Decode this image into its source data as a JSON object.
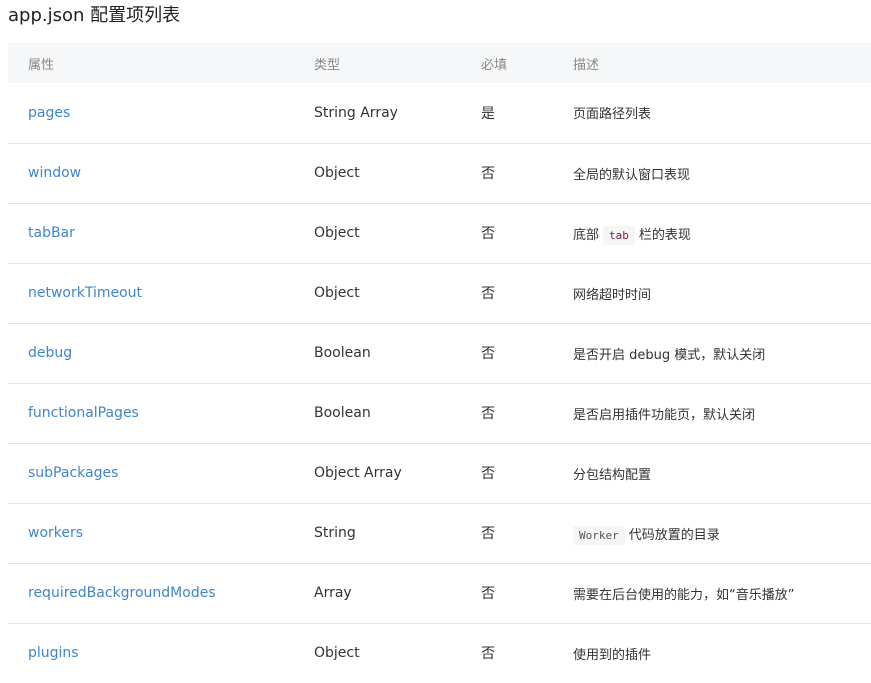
{
  "title": "app.json 配置项列表",
  "headers": [
    "属性",
    "类型",
    "必填",
    "描述"
  ],
  "rows": [
    {
      "name": "pages",
      "type": "String Array",
      "required": "是",
      "desc": "页面路径列表"
    },
    {
      "name": "window",
      "type": "Object",
      "required": "否",
      "desc": "全局的默认窗口表现"
    },
    {
      "name": "tabBar",
      "type": "Object",
      "required": "否",
      "desc_before": "底部",
      "desc_code": "tab",
      "desc_after": "栏的表现"
    },
    {
      "name": "networkTimeout",
      "type": "Object",
      "required": "否",
      "desc": "网络超时时间"
    },
    {
      "name": "debug",
      "type": "Boolean",
      "required": "否",
      "desc": "是否开启 debug 模式，默认关闭"
    },
    {
      "name": "functionalPages",
      "type": "Boolean",
      "required": "否",
      "desc": "是否启用插件功能页，默认关闭"
    },
    {
      "name": "subPackages",
      "type": "Object Array",
      "required": "否",
      "desc": "分包结构配置"
    },
    {
      "name": "workers",
      "type": "String",
      "required": "否",
      "desc_code": "Worker",
      "desc_after": "代码放置的目录"
    },
    {
      "name": "requiredBackgroundModes",
      "type": "Array",
      "required": "否",
      "desc": "需要在后台使用的能力，如“音乐播放”"
    },
    {
      "name": "plugins",
      "type": "Object",
      "required": "否",
      "desc": "使用到的插件"
    }
  ]
}
